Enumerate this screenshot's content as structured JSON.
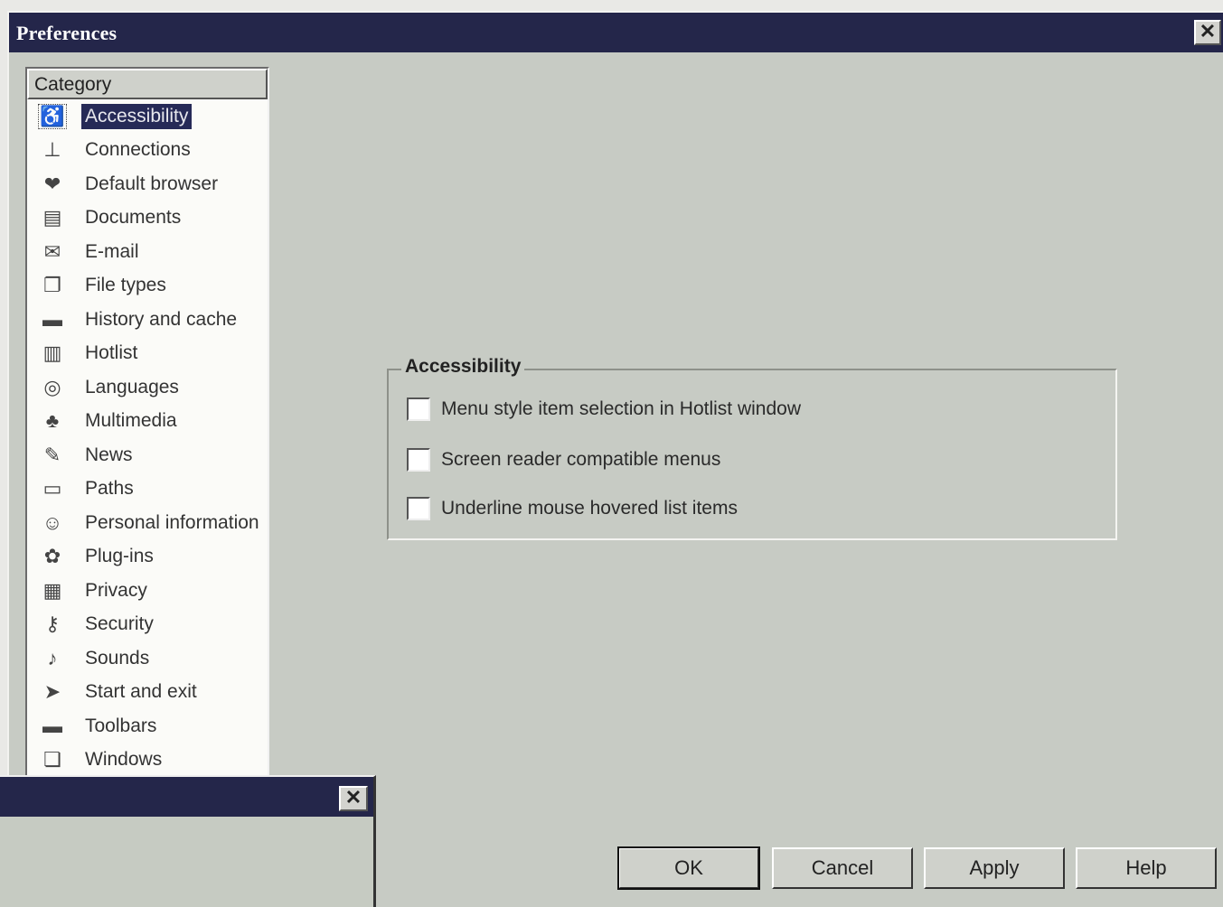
{
  "window": {
    "title": "Preferences",
    "close_glyph": "✕"
  },
  "category": {
    "header": "Category",
    "items": [
      {
        "label": "Accessibility",
        "icon": "accessibility-icon",
        "glyph": "♿",
        "selected": true
      },
      {
        "label": "Connections",
        "icon": "connections-icon",
        "glyph": "⊥"
      },
      {
        "label": "Default browser",
        "icon": "default-browser-icon",
        "glyph": "❤"
      },
      {
        "label": "Documents",
        "icon": "documents-icon",
        "glyph": "▤"
      },
      {
        "label": "E-mail",
        "icon": "email-icon",
        "glyph": "✉"
      },
      {
        "label": "File types",
        "icon": "file-types-icon",
        "glyph": "❐"
      },
      {
        "label": "History and cache",
        "icon": "history-cache-icon",
        "glyph": "▬"
      },
      {
        "label": "Hotlist",
        "icon": "hotlist-icon",
        "glyph": "▥"
      },
      {
        "label": "Languages",
        "icon": "languages-icon",
        "glyph": "◎"
      },
      {
        "label": "Multimedia",
        "icon": "multimedia-icon",
        "glyph": "♣"
      },
      {
        "label": "News",
        "icon": "news-icon",
        "glyph": "✎"
      },
      {
        "label": "Paths",
        "icon": "folder-icon",
        "glyph": "▭"
      },
      {
        "label": "Personal information",
        "icon": "person-icon",
        "glyph": "☺"
      },
      {
        "label": "Plug-ins",
        "icon": "plugins-icon",
        "glyph": "✿"
      },
      {
        "label": "Privacy",
        "icon": "privacy-icon",
        "glyph": "▦"
      },
      {
        "label": "Security",
        "icon": "security-icon",
        "glyph": "⚷"
      },
      {
        "label": "Sounds",
        "icon": "sounds-icon",
        "glyph": "♪"
      },
      {
        "label": "Start and exit",
        "icon": "start-exit-icon",
        "glyph": "➤"
      },
      {
        "label": "Toolbars",
        "icon": "toolbars-icon",
        "glyph": "▬"
      },
      {
        "label": "Windows",
        "icon": "windows-icon",
        "glyph": "❏"
      }
    ]
  },
  "accessibility": {
    "group_title": "Accessibility",
    "options": [
      {
        "label": "Menu style item selection in Hotlist window",
        "checked": false
      },
      {
        "label": "Screen reader compatible menus",
        "checked": false
      },
      {
        "label": "Underline mouse hovered list items",
        "checked": false
      }
    ]
  },
  "buttons": {
    "ok": "OK",
    "cancel": "Cancel",
    "apply": "Apply",
    "help": "Help"
  },
  "small_window": {
    "close_glyph": "✕"
  }
}
